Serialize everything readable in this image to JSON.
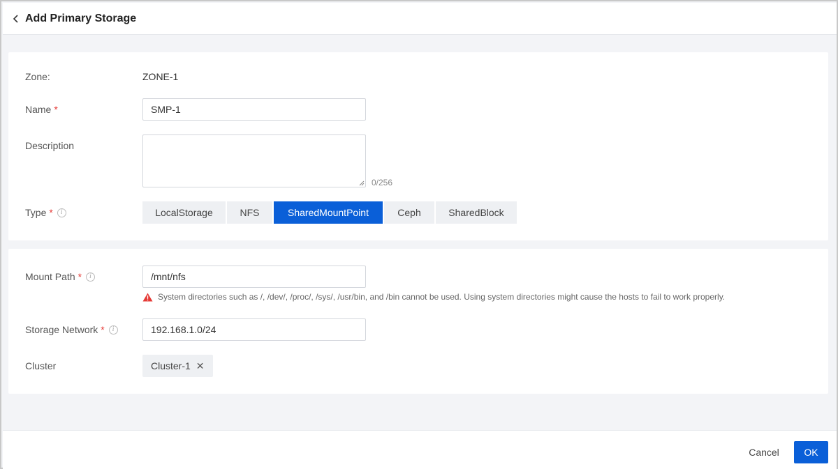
{
  "header": {
    "title": "Add Primary Storage",
    "back_icon": "chevron-left-icon"
  },
  "basic": {
    "zone_label": "Zone:",
    "zone_value": "ZONE-1",
    "name_label": "Name",
    "name_value": "SMP-1",
    "description_label": "Description",
    "description_value": "",
    "description_counter": "0/256",
    "type_label": "Type",
    "required_mark": "*",
    "types": [
      {
        "label": "LocalStorage",
        "active": false
      },
      {
        "label": "NFS",
        "active": false
      },
      {
        "label": "SharedMountPoint",
        "active": true
      },
      {
        "label": "Ceph",
        "active": false
      },
      {
        "label": "SharedBlock",
        "active": false
      }
    ]
  },
  "storage": {
    "mount_path_label": "Mount Path",
    "mount_path_value": "/mnt/nfs",
    "warning": "System directories such as /, /dev/, /proc/, /sys/, /usr/bin, and /bin cannot be used. Using system directories might cause the hosts to fail to work properly.",
    "storage_network_label": "Storage Network",
    "storage_network_value": "192.168.1.0/24",
    "cluster_label": "Cluster",
    "cluster_tag": "Cluster-1"
  },
  "footer": {
    "cancel_label": "Cancel",
    "ok_label": "OK"
  },
  "colors": {
    "primary": "#0a5fd8",
    "required": "#e53935",
    "warning": "#e53935"
  }
}
